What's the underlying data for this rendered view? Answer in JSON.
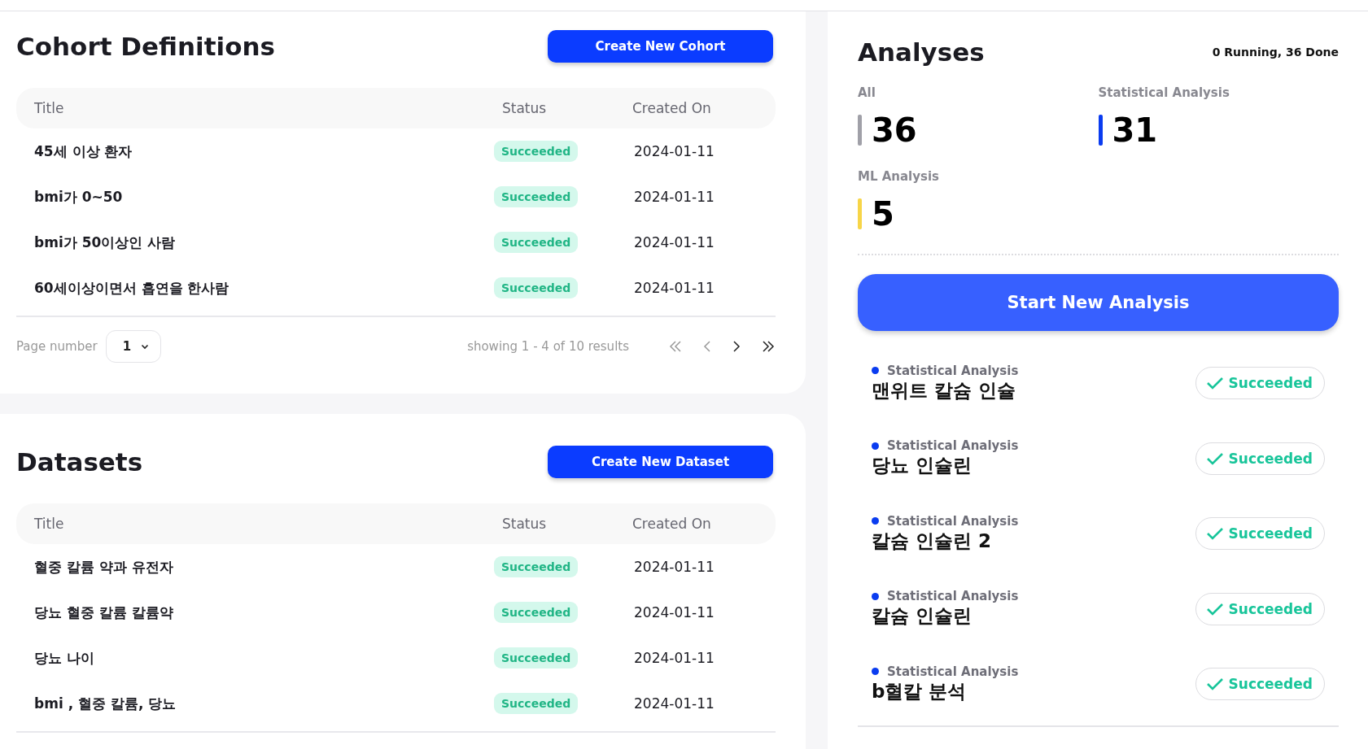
{
  "cohorts": {
    "title": "Cohort Definitions",
    "create_button": "Create New Cohort",
    "columns": [
      "Title",
      "Status",
      "Created On"
    ],
    "rows": [
      {
        "title": "45세 이상 환자",
        "status": "Succeeded",
        "created_on": "2024-01-11"
      },
      {
        "title": "bmi가 0~50",
        "status": "Succeeded",
        "created_on": "2024-01-11"
      },
      {
        "title": "bmi가 50이상인 사람",
        "status": "Succeeded",
        "created_on": "2024-01-11"
      },
      {
        "title": "60세이상이면서 흡연을 한사람",
        "status": "Succeeded",
        "created_on": "2024-01-11"
      }
    ],
    "pagination": {
      "label": "Page number",
      "page": "1",
      "summary": "showing 1 - 4 of 10 results"
    }
  },
  "datasets": {
    "title": "Datasets",
    "create_button": "Create New Dataset",
    "columns": [
      "Title",
      "Status",
      "Created On"
    ],
    "rows": [
      {
        "title": "혈중 칼륨 약과 유전자",
        "status": "Succeeded",
        "created_on": "2024-01-11"
      },
      {
        "title": "당뇨 혈중 칼륨 칼륨약",
        "status": "Succeeded",
        "created_on": "2024-01-11"
      },
      {
        "title": "당뇨 나이",
        "status": "Succeeded",
        "created_on": "2024-01-11"
      },
      {
        "title": "bmi , 혈중 칼륨, 당뇨",
        "status": "Succeeded",
        "created_on": "2024-01-11"
      }
    ]
  },
  "analyses": {
    "title": "Analyses",
    "summary": "0 Running, 36 Done",
    "stats": [
      {
        "label": "All",
        "value": "36",
        "color": "#a0a0a8"
      },
      {
        "label": "Statistical Analysis",
        "value": "31",
        "color": "#0a3cf0"
      },
      {
        "label": "ML Analysis",
        "value": "5",
        "color": "#f7d548"
      }
    ],
    "start_button": "Start New Analysis",
    "items": [
      {
        "type": "Statistical Analysis",
        "color": "#0a3cf0",
        "name": "맨위트 칼슘 인슐",
        "status": "Succeeded"
      },
      {
        "type": "Statistical Analysis",
        "color": "#0a3cf0",
        "name": "당뇨 인슐린",
        "status": "Succeeded"
      },
      {
        "type": "Statistical Analysis",
        "color": "#0a3cf0",
        "name": "칼슘 인슐린 2",
        "status": "Succeeded"
      },
      {
        "type": "Statistical Analysis",
        "color": "#0a3cf0",
        "name": "칼슘 인슐린",
        "status": "Succeeded"
      },
      {
        "type": "Statistical Analysis",
        "color": "#0a3cf0",
        "name": "b혈칼 분석",
        "status": "Succeeded"
      }
    ]
  }
}
